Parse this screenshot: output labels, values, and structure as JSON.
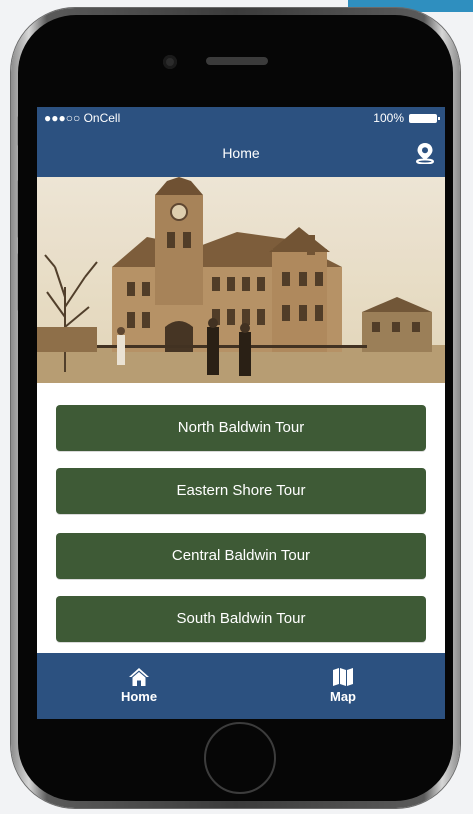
{
  "status_bar": {
    "carrier": "●●●○○ OnCell",
    "battery": "100%"
  },
  "nav": {
    "title": "Home",
    "right_icon": "location-pin-icon"
  },
  "hero": {
    "subject": "historic courthouse sepia photograph"
  },
  "tours": [
    {
      "label": "North Baldwin Tour"
    },
    {
      "label": "Eastern Shore Tour"
    },
    {
      "label": "Central Baldwin Tour"
    },
    {
      "label": "South Baldwin Tour"
    }
  ],
  "tab_bar": {
    "items": [
      {
        "label": "Home",
        "icon": "home-icon"
      },
      {
        "label": "Map",
        "icon": "map-icon"
      }
    ]
  },
  "colors": {
    "brand_blue": "#2c5180",
    "tour_green": "#3e5a36"
  }
}
